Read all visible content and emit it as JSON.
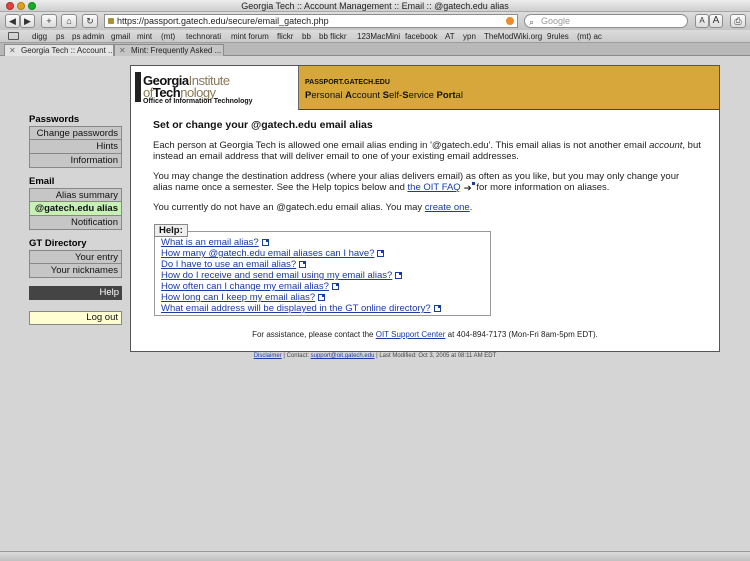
{
  "browser": {
    "window_title": "Georgia Tech :: Account Management :: Email :: @gatech.edu alias",
    "url": "https://passport.gatech.edu/secure/email_gatech.php",
    "search_placeholder": "Google",
    "buttons": {
      "back": "◀",
      "forward": "▶",
      "add": "+",
      "home": "⌂",
      "reload": "↻",
      "text_smaller": "A",
      "text_larger": "A",
      "print": "⎙"
    },
    "bookmarks": [
      "digg",
      "ps",
      "ps admin",
      "gmail",
      "mint",
      "(mt)",
      "technorati",
      "mint forum",
      "flickr",
      "bb",
      "bb flickr",
      "123MacMini",
      "facebook",
      "AT",
      "ypn",
      "TheModWiki.org",
      "9rules",
      "(mt) ac"
    ],
    "tabs": [
      {
        "label": "Georgia Tech :: Account ...",
        "active": true
      },
      {
        "label": "Mint: Frequently Asked ...",
        "active": false
      }
    ]
  },
  "header": {
    "logo_line1_bold": "Georgia",
    "logo_line1_light": "Institute",
    "logo_line2_bold": "Tech",
    "logo_line2_light": "nology",
    "logo_line2_prefix": "of",
    "logo_line3": "Office of Information Technology",
    "portal_url": "PASSPORT.GATECH.EDU",
    "portal_name_parts": [
      "P",
      "ersonal ",
      "A",
      "ccount ",
      "S",
      "elf-",
      "S",
      "ervice ",
      "Port",
      "al"
    ]
  },
  "sidebar": {
    "groups": [
      {
        "heading": "Passwords",
        "items": [
          "Change passwords",
          "Hints",
          "Information"
        ]
      },
      {
        "heading": "Email",
        "items": [
          "Alias summary",
          "@gatech.edu alias",
          "Notification"
        ]
      },
      {
        "heading": "GT Directory",
        "items": [
          "Your entry",
          "Your nicknames"
        ]
      }
    ],
    "active_item": "@gatech.edu alias",
    "help": "Help",
    "logout": "Log out"
  },
  "main": {
    "title": "Set or change your @gatech.edu email alias",
    "p1_before": "Each person at Georgia Tech is allowed one email alias ending in '@gatech.edu'. This email alias is not another email ",
    "p1_em": "account",
    "p1_after": ", but instead an email address that will deliver email to one of your existing email addresses.",
    "p2_before": "You may change the destination address (where your alias delivers email) as often as you like, but you may only change your alias name once a semester. See the Help topics below and ",
    "p2_link": "the OIT FAQ",
    "p2_after": " for more information on aliases.",
    "p3_before": "You currently do not have an @gatech.edu email alias. You may ",
    "p3_link": "create one",
    "p3_after": ".",
    "help_label": "Help:",
    "help_items": [
      "What is an email alias?",
      "How many @gatech.edu email aliases can I have?",
      "Do I have to use an email alias?",
      "How do I receive and send email using my email alias?",
      "How often can I change my email alias?",
      "How long can I keep my email alias?",
      "What email address will be displayed in the GT online directory?"
    ],
    "assist_before": "For assistance, please contact the ",
    "assist_link": "OIT Support Center",
    "assist_after": " at 404-894-7173 (Mon-Fri 8am-5pm EDT)."
  },
  "footer": {
    "disclaimer": "Disclaimer",
    "contact_label": "Contact: ",
    "contact_email": "support@oit.gatech.edu",
    "last_modified": "Last Modified: Oct 3, 2005 at 08:11 AM EDT",
    "sep": "|"
  }
}
